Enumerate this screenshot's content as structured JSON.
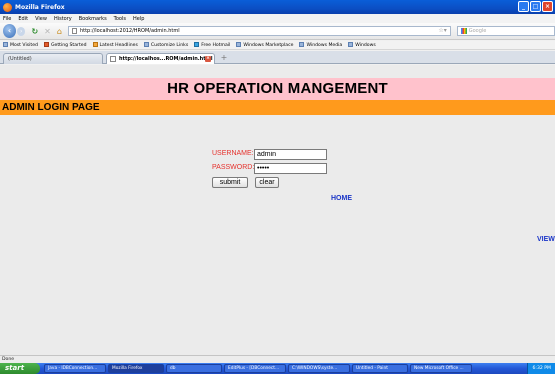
{
  "window": {
    "title": "Mozilla Firefox"
  },
  "menubar": [
    "File",
    "Edit",
    "View",
    "History",
    "Bookmarks",
    "Tools",
    "Help"
  ],
  "navbar": {
    "url": "http://localhost:2012/HROM/admin.html",
    "search_placeholder": "Google"
  },
  "bookmarks": [
    "Most Visited",
    "Getting Started",
    "Latest Headlines",
    "Customize Links",
    "Free Hotmail",
    "Windows Marketplace",
    "Windows Media",
    "Windows"
  ],
  "tabs": [
    {
      "label": "(Untitled)"
    },
    {
      "label": "http://localhos...ROM/admin.html"
    }
  ],
  "page": {
    "header": "HR OPERATION MANGEMENT",
    "subheader": "ADMIN LOGIN PAGE",
    "username_label": "USERNAME:",
    "username_value": "admin",
    "password_label": "PASSWORD:",
    "password_value": "•••••",
    "submit_label": "submit",
    "clear_label": "clear",
    "home_link": "HOME",
    "view_link": "VIEW"
  },
  "status": {
    "text": "Done"
  },
  "taskbar": {
    "start_label": "start",
    "tasks": [
      "Java - IDBConnection...",
      "Mozilla Firefox",
      "db",
      "EditPlus - [DBConnect...",
      "C:\\WINDOWS\\syste...",
      "Untitled - Paint",
      "New Microsoft Office ..."
    ],
    "clock": "6:32 PM"
  }
}
